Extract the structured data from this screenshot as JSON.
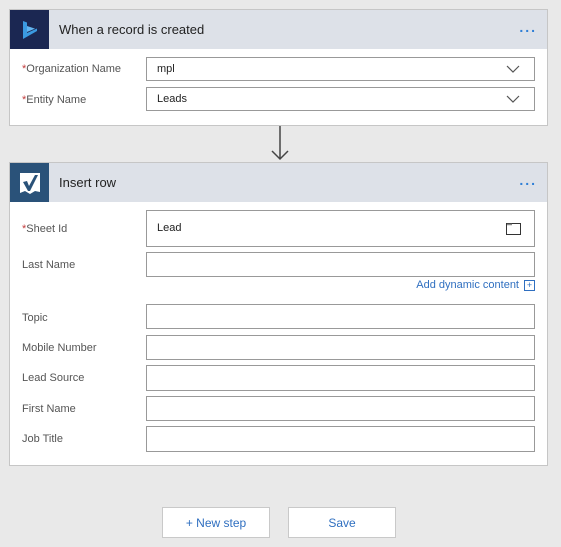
{
  "trigger": {
    "title": "When a record is created",
    "icon": "dynamics-logo-icon",
    "more_label": "...",
    "fields": [
      {
        "label": "Organization Name",
        "required": true,
        "value": "mpl",
        "control": "dropdown"
      },
      {
        "label": "Entity Name",
        "required": true,
        "value": "Leads",
        "control": "dropdown"
      }
    ]
  },
  "connector_arrow": "down-arrow-icon",
  "action": {
    "title": "Insert row",
    "icon": "smartsheet-logo-icon",
    "more_label": "...",
    "fields": [
      {
        "label": "Sheet Id",
        "required": true,
        "value": "Lead",
        "control": "file-picker"
      },
      {
        "label": "Last Name",
        "required": false,
        "value": "",
        "control": "text"
      },
      {
        "label": "Topic",
        "required": false,
        "value": "",
        "control": "text"
      },
      {
        "label": "Mobile Number",
        "required": false,
        "value": "",
        "control": "text"
      },
      {
        "label": "Lead Source",
        "required": false,
        "value": "",
        "control": "text"
      },
      {
        "label": "First Name",
        "required": false,
        "value": "",
        "control": "text"
      },
      {
        "label": "Job Title",
        "required": false,
        "value": "",
        "control": "text"
      }
    ],
    "dynamic_content_label": "Add dynamic content",
    "dynamic_content_icon": "+"
  },
  "buttons": {
    "new_step": "+ New step",
    "save": "Save"
  },
  "required_marker": "*",
  "colors": {
    "accent": "#2f6fc0",
    "header_bg": "#dde1e8",
    "trigger_icon_bg": "#1b2752",
    "action_icon_bg": "#2a5279",
    "required": "#c23b3b"
  }
}
